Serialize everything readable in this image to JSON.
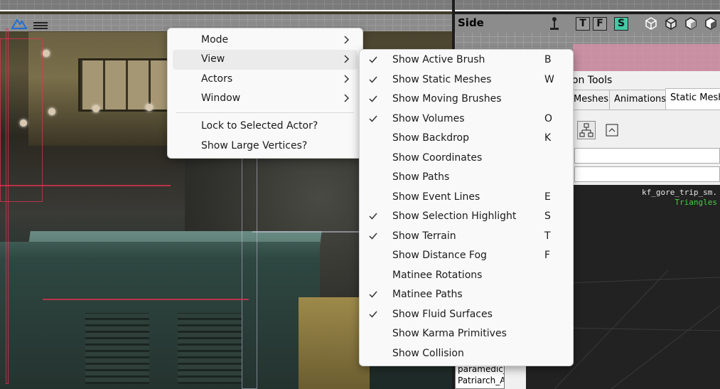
{
  "main_menu": {
    "items": [
      {
        "label": "Mode",
        "submenu": true
      },
      {
        "label": "View",
        "submenu": true,
        "highlighted": true
      },
      {
        "label": "Actors",
        "submenu": true
      },
      {
        "label": "Window",
        "submenu": true
      },
      {
        "label": "Lock to Selected Actor?",
        "submenu": false
      },
      {
        "label": "Show Large Vertices?",
        "submenu": false
      }
    ]
  },
  "view_menu": {
    "items": [
      {
        "label": "Show Active Brush",
        "shortcut": "B",
        "checked": true
      },
      {
        "label": "Show Static Meshes",
        "shortcut": "W",
        "checked": true
      },
      {
        "label": "Show Moving Brushes",
        "shortcut": "",
        "checked": true
      },
      {
        "label": "Show Volumes",
        "shortcut": "O",
        "checked": true
      },
      {
        "label": "Show Backdrop",
        "shortcut": "K",
        "checked": false
      },
      {
        "label": "Show Coordinates",
        "shortcut": "",
        "checked": false
      },
      {
        "label": "Show Paths",
        "shortcut": "",
        "checked": false
      },
      {
        "label": "Show Event Lines",
        "shortcut": "E",
        "checked": false
      },
      {
        "label": "Show Selection Highlight",
        "shortcut": "S",
        "checked": true
      },
      {
        "label": "Show Terrain",
        "shortcut": "T",
        "checked": true
      },
      {
        "label": "Show Distance Fog",
        "shortcut": "F",
        "checked": false
      },
      {
        "label": "Matinee Rotations",
        "shortcut": "",
        "checked": false
      },
      {
        "label": "Matinee Paths",
        "shortcut": "",
        "checked": true
      },
      {
        "label": "Show Fluid Surfaces",
        "shortcut": "",
        "checked": true
      },
      {
        "label": "Show Karma Primitives",
        "shortcut": "",
        "checked": false
      },
      {
        "label": "Show Collision",
        "shortcut": "",
        "checked": false
      }
    ]
  },
  "side_viewport": {
    "title": "Side",
    "buttons": [
      "T",
      "F",
      "S"
    ],
    "active_button": "S"
  },
  "browser": {
    "title": "ion Tools",
    "tabs": [
      "Meshes",
      "Animations",
      "Static Meshe"
    ],
    "active_tab": "Static Meshe",
    "preview_name": "kf_gore_trip_sm.",
    "preview_stat": "Triangles",
    "list_items": [
      "paramedic_",
      "Patriarch_A"
    ]
  },
  "colors": {
    "active_button": "#45c7a4",
    "menu_background": "#f9f9f9",
    "menu_hover": "#ebebeb",
    "wireframe": "#e63250",
    "preview_stat": "#40d040"
  }
}
